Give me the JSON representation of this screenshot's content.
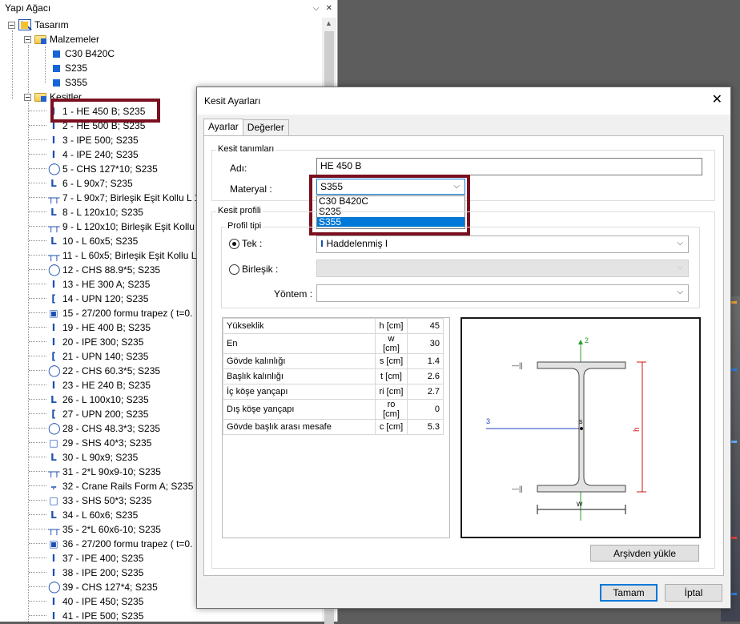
{
  "tree": {
    "title": "Yapı Ağacı",
    "root": "Tasarım",
    "materials_folder": "Malzemeler",
    "materials": [
      "C30 B420C",
      "S235",
      "S355"
    ],
    "sections_folder": "Kesitler",
    "sections": [
      {
        "label": "1 - HE 450 B; S235",
        "icon": "i-beam"
      },
      {
        "label": "2 - HE 500 B; S235",
        "icon": "i-beam"
      },
      {
        "label": "3 - IPE 500; S235",
        "icon": "i-beam"
      },
      {
        "label": "4 - IPE 240; S235",
        "icon": "i-beam"
      },
      {
        "label": "5 - CHS 127*10; S235",
        "icon": "circle"
      },
      {
        "label": "6 - L 90x7; S235",
        "icon": "angle"
      },
      {
        "label": "7 - L 90x7; Birleşik Eşit Kollu L 1",
        "icon": "double-angle"
      },
      {
        "label": "8 - L 120x10; S235",
        "icon": "angle"
      },
      {
        "label": "9 - L 120x10; Birleşik Eşit Kollu",
        "icon": "double-angle"
      },
      {
        "label": "10 - L 60x5; S235",
        "icon": "angle"
      },
      {
        "label": "11 - L 60x5; Birleşik Eşit Kollu L",
        "icon": "double-angle"
      },
      {
        "label": "12 - CHS 88.9*5; S235",
        "icon": "circle"
      },
      {
        "label": "13 - HE 300 A; S235",
        "icon": "i-beam"
      },
      {
        "label": "14 - UPN 120; S235",
        "icon": "channel"
      },
      {
        "label": "15 - 27/200 formu trapez ( t=0.",
        "icon": "trapez"
      },
      {
        "label": "19 - HE 400 B; S235",
        "icon": "i-beam"
      },
      {
        "label": "20 - IPE 300; S235",
        "icon": "i-beam"
      },
      {
        "label": "21 - UPN 140; S235",
        "icon": "channel"
      },
      {
        "label": "22 - CHS 60.3*5; S235",
        "icon": "circle"
      },
      {
        "label": "23 - HE 240 B; S235",
        "icon": "i-beam"
      },
      {
        "label": "26 - L 100x10; S235",
        "icon": "angle"
      },
      {
        "label": "27 - UPN 200; S235",
        "icon": "channel"
      },
      {
        "label": "28 - CHS 48.3*3; S235",
        "icon": "circle"
      },
      {
        "label": "29 - SHS 40*3; S235",
        "icon": "square"
      },
      {
        "label": "30 - L 90x9; S235",
        "icon": "angle"
      },
      {
        "label": "31 - 2*L 90x9-10; S235",
        "icon": "double-angle"
      },
      {
        "label": "32 - Crane Rails Form A; S235",
        "icon": "rail"
      },
      {
        "label": "33 - SHS 50*3; S235",
        "icon": "square"
      },
      {
        "label": "34 - L 60x6; S235",
        "icon": "angle"
      },
      {
        "label": "35 - 2*L 60x6-10; S235",
        "icon": "double-angle"
      },
      {
        "label": "36 - 27/200 formu trapez ( t=0.",
        "icon": "trapez"
      },
      {
        "label": "37 - IPE 400; S235",
        "icon": "i-beam"
      },
      {
        "label": "38 - IPE 200; S235",
        "icon": "i-beam"
      },
      {
        "label": "39 - CHS 127*4; S235",
        "icon": "circle"
      },
      {
        "label": "40 - IPE 450; S235",
        "icon": "i-beam"
      },
      {
        "label": "41 - IPE 500; S235",
        "icon": "i-beam"
      }
    ]
  },
  "dialog": {
    "title": "Kesit Ayarları",
    "tabs": [
      "Ayarlar",
      "Değerler"
    ],
    "definitions_group": "Kesit tanımları",
    "name_label": "Adı:",
    "name_value": "HE 450 B",
    "material_label": "Materyal :",
    "material_value": "S355",
    "material_options": [
      "C30 B420C",
      "S235",
      "S355"
    ],
    "profile_group": "Kesit profili",
    "profile_type_group": "Profil tipi",
    "radio_single": "Tek :",
    "radio_single_value": "Haddelenmiş I",
    "radio_combined": "Birleşik :",
    "method_label": "Yöntem :",
    "props": [
      {
        "name": "Yükseklik",
        "unit": "h [cm]",
        "value": "45"
      },
      {
        "name": "En",
        "unit": "w [cm]",
        "value": "30"
      },
      {
        "name": "Gövde kalınlığı",
        "unit": "s [cm]",
        "value": "1.4"
      },
      {
        "name": "Başlık kalınlığı",
        "unit": "t [cm]",
        "value": "2.6"
      },
      {
        "name": "İç köşe yançapı",
        "unit": "ri [cm]",
        "value": "2.7"
      },
      {
        "name": "Dış köşe yançapı",
        "unit": "ro [cm]",
        "value": "0"
      },
      {
        "name": "Gövde başlık arası mesafe",
        "unit": "c [cm]",
        "value": "5.3"
      }
    ],
    "drawing_labels": {
      "axis2": "2",
      "axis3": "3",
      "height": "h",
      "width": "w",
      "s": "s"
    },
    "archive_button": "Arşivden yükle",
    "ok_button": "Tamam",
    "cancel_button": "İptal"
  },
  "colors": {
    "highlight": "#7a1020",
    "selection": "#0078d7",
    "icon_blue": "#1c4fb2"
  }
}
